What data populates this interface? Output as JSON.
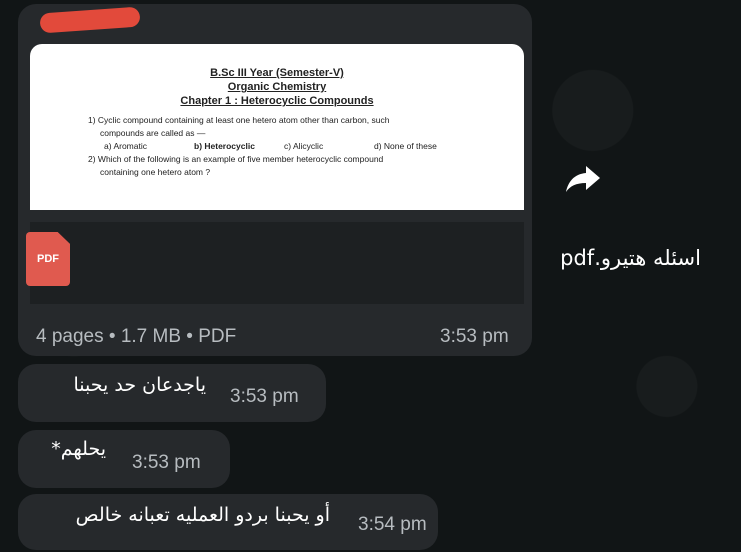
{
  "document": {
    "line1": "B.Sc III Year (Semester-V)",
    "line2": "Organic Chemistry",
    "line3": "Chapter 1 : Heterocyclic Compounds",
    "q1a": "1) Cyclic compound containing at least one hetero atom other than carbon, such",
    "q1b": "compounds are called as —",
    "opt_a": "a) Aromatic",
    "opt_b": "b) Heterocyclic",
    "opt_c": "c) Alicyclic",
    "opt_d": "d) None of these",
    "q2a": "2) Which of the following is an example of five member heterocyclic compound",
    "q2b": "containing one hetero atom ?"
  },
  "file": {
    "icon_label": "PDF",
    "name": "اسئله هتيرو.pdf",
    "meta": "4 pages • 1.7 MB • PDF",
    "time": "3:53 pm"
  },
  "messages": [
    {
      "text": "ياجدعان حد يحبنا",
      "time": "3:53 pm"
    },
    {
      "text": "يحلهم*",
      "time": "3:53 pm"
    },
    {
      "text": "أو يحبنا بردو العمليه تعبانه خالص",
      "time": "3:54 pm"
    }
  ],
  "icons": {
    "forward": "share-forward-icon",
    "pdf": "pdf-file-icon"
  },
  "colors": {
    "bubble": "#26292c",
    "background": "#111516",
    "pdf_red": "#e05a4f",
    "redaction": "#e24a3b"
  }
}
